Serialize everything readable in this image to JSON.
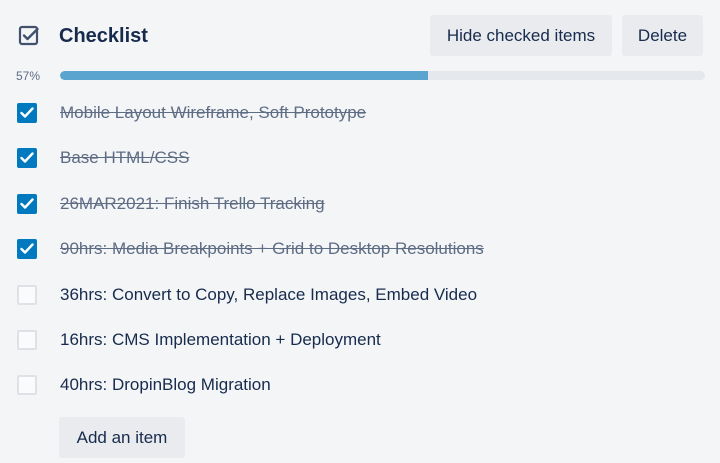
{
  "checklist": {
    "title": "Checklist",
    "title_icon": "checkbox-icon",
    "hide_checked_label": "Hide checked items",
    "delete_label": "Delete",
    "progress_text": "57%",
    "progress_value": 0.57,
    "progress_color": "#5ba4cf",
    "accent_color": "#0079bf",
    "add_item_label": "Add an item",
    "items": [
      {
        "text": "Mobile Layout Wireframe, Soft Prototype",
        "checked": true
      },
      {
        "text": "Base HTML/CSS",
        "checked": true
      },
      {
        "text": "26MAR2021: Finish Trello Tracking",
        "checked": true
      },
      {
        "text": "90hrs: Media Breakpoints + Grid to Desktop Resolutions",
        "checked": true
      },
      {
        "text": "36hrs: Convert to Copy, Replace Images, Embed Video",
        "checked": false
      },
      {
        "text": "16hrs: CMS Implementation + Deployment",
        "checked": false
      },
      {
        "text": "40hrs: DropinBlog Migration",
        "checked": false
      }
    ]
  }
}
